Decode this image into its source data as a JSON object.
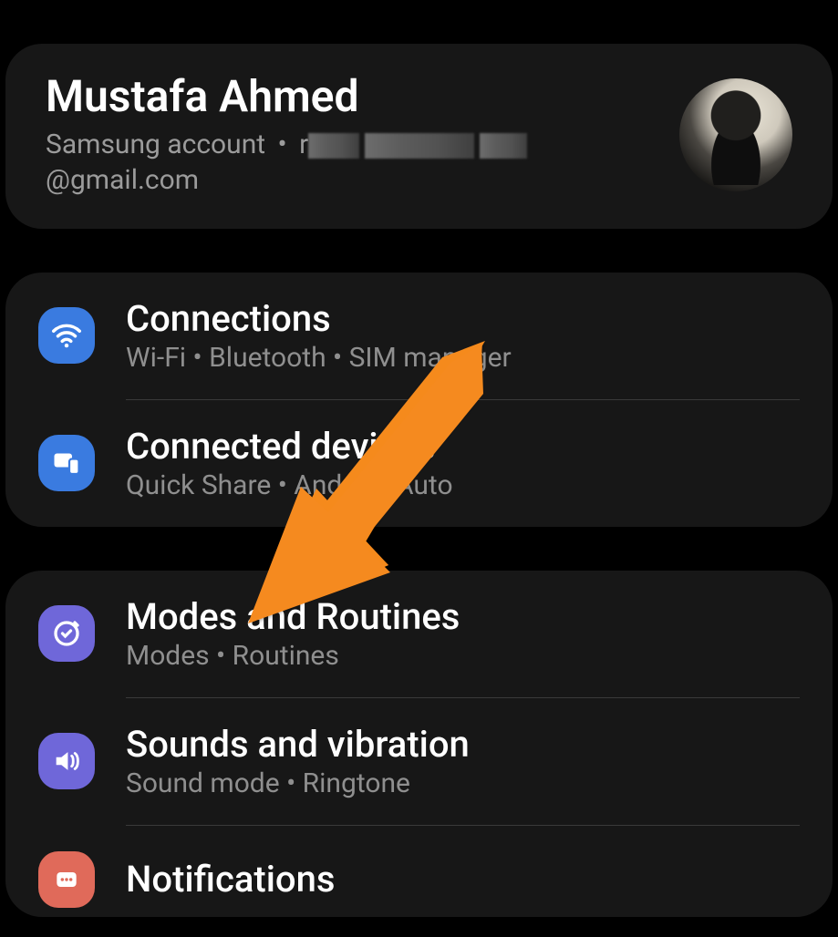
{
  "account": {
    "name": "Mustafa Ahmed",
    "sub_prefix": "Samsung account",
    "email_suffix": "@gmail.com"
  },
  "groups": [
    {
      "items": [
        {
          "key": "connections",
          "title": "Connections",
          "sub": "Wi-Fi  •  Bluetooth  •  SIM manager"
        },
        {
          "key": "connected_devices",
          "title": "Connected devices",
          "sub": "Quick Share  •  Android Auto"
        }
      ]
    },
    {
      "items": [
        {
          "key": "modes_routines",
          "title": "Modes and Routines",
          "sub": "Modes  •  Routines"
        },
        {
          "key": "sounds_vibration",
          "title": "Sounds and vibration",
          "sub": "Sound mode  •  Ringtone"
        },
        {
          "key": "notifications",
          "title": "Notifications",
          "sub": ""
        }
      ]
    }
  ],
  "colors": {
    "card_bg": "#171717",
    "accent_blue": "#3a7be0",
    "accent_purple": "#6f67d9",
    "accent_red": "#e06a5a",
    "arrow": "#f58a1f"
  },
  "annotation": {
    "arrow_target": "modes_routines"
  }
}
